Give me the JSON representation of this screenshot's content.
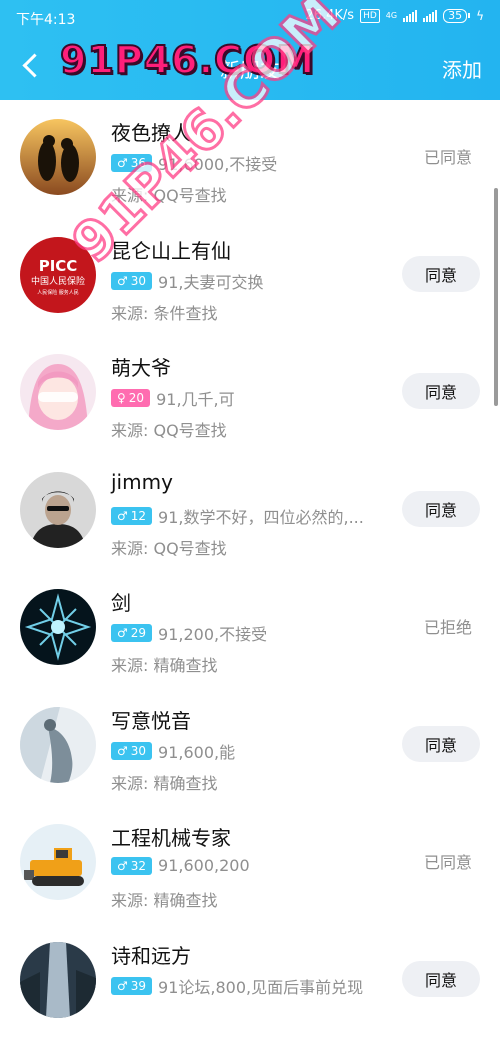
{
  "status_bar": {
    "time": "下午4:13",
    "speed": "26.4K/s",
    "hd": "HD",
    "network": "4G",
    "battery": "35"
  },
  "nav": {
    "title": "新朋友",
    "add": "添加"
  },
  "watermark": {
    "top": "91P46.COM",
    "diagonal": "91P46.COM"
  },
  "source_prefix": "来源: ",
  "requests": [
    {
      "name": "夜色撩人",
      "gender": "male",
      "gender_icon": "♂",
      "age": "36",
      "message": "91,6000,不接受",
      "source": "来源: QQ号查找",
      "action_type": "status",
      "action": "已同意"
    },
    {
      "name": "昆仑山上有仙",
      "gender": "male",
      "gender_icon": "♂",
      "age": "30",
      "message": "91,夫妻可交换",
      "source": "来源: 条件查找",
      "action_type": "button",
      "action": "同意"
    },
    {
      "name": "萌大爷",
      "gender": "female",
      "gender_icon": "♀",
      "age": "20",
      "message": "91,几千,可",
      "source": "来源: QQ号查找",
      "action_type": "button",
      "action": "同意"
    },
    {
      "name": "jimmy",
      "gender": "male",
      "gender_icon": "♂",
      "age": "12",
      "message": "91,数学不好，四位必然的,...",
      "source": "来源: QQ号查找",
      "action_type": "button",
      "action": "同意"
    },
    {
      "name": "剑",
      "gender": "male",
      "gender_icon": "♂",
      "age": "29",
      "message": "91,200,不接受",
      "source": "来源: 精确查找",
      "action_type": "status",
      "action": "已拒绝"
    },
    {
      "name": "写意悦音",
      "gender": "male",
      "gender_icon": "♂",
      "age": "30",
      "message": "91,600,能",
      "source": "来源: 精确查找",
      "action_type": "button",
      "action": "同意"
    },
    {
      "name": "工程机械专家",
      "gender": "male",
      "gender_icon": "♂",
      "age": "32",
      "message": "91,600,200",
      "source": "来源: 精确查找",
      "action_type": "status",
      "action": "已同意"
    },
    {
      "name": "诗和远方",
      "gender": "male",
      "gender_icon": "♂",
      "age": "39",
      "message": "91论坛,800,见面后事前兑现",
      "source": "",
      "action_type": "button",
      "action": "同意"
    }
  ],
  "avatar_logo": {
    "brand": "PICC",
    "line1": "中国人民保险",
    "line2": "人民保险 服务人民"
  },
  "colors": {
    "header": "#23b4f0",
    "male_tag": "#3bc3f0",
    "female_tag": "#ff6cb0",
    "button_bg": "#eef0f4",
    "secondary_text": "#8f8f8f"
  },
  "icons": [
    "back-arrow-icon",
    "signal-icon",
    "battery-icon"
  ]
}
